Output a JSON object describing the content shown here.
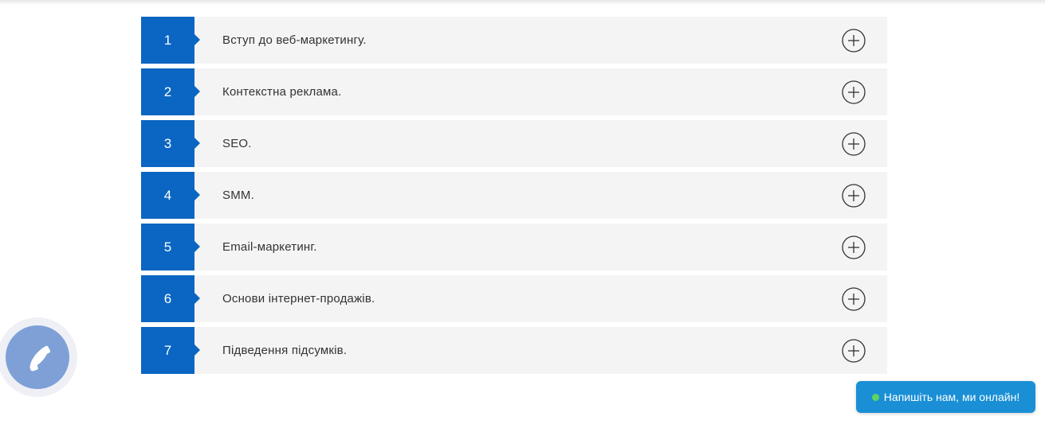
{
  "accordion": {
    "items": [
      {
        "number": "1",
        "title": "Вступ до веб-маркетингу."
      },
      {
        "number": "2",
        "title": "Контекстна реклама."
      },
      {
        "number": "3",
        "title": "SEO."
      },
      {
        "number": "4",
        "title": "SMM."
      },
      {
        "number": "5",
        "title": "Email-маркетинг."
      },
      {
        "number": "6",
        "title": "Основи інтернет-продажів."
      },
      {
        "number": "7",
        "title": "Підведення підсумків."
      }
    ],
    "expand_icon": "plus-circle-icon"
  },
  "widgets": {
    "phone_icon": "phone-icon",
    "chat_label": "Напишіть нам, ми онлайн!"
  },
  "colors": {
    "accent": "#0a66c2",
    "row_background": "#f4f4f4",
    "chat_button": "#1a8fd6",
    "phone_circle": "#7ea0d6",
    "online": "#5ed55e"
  }
}
